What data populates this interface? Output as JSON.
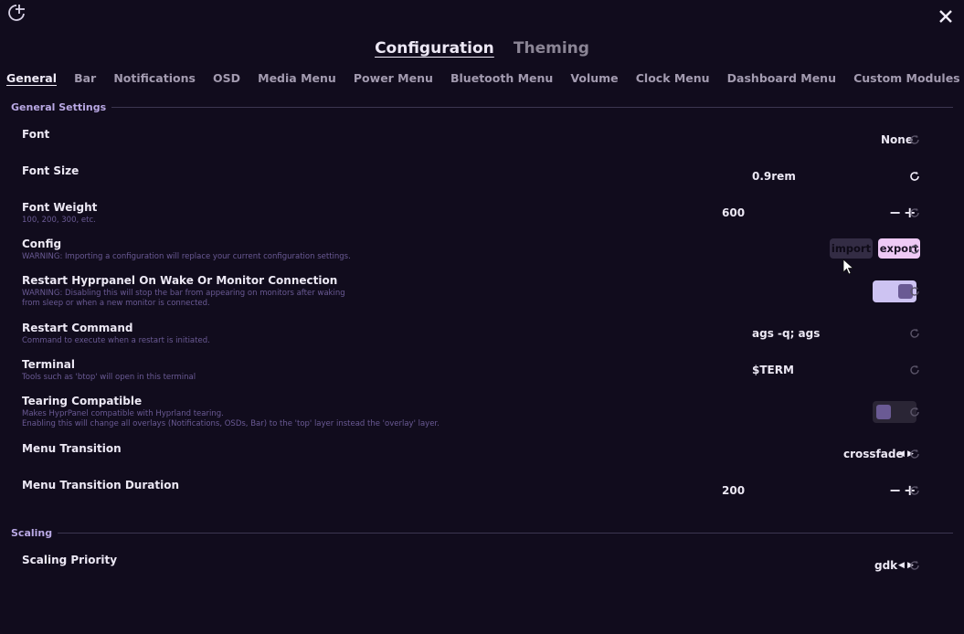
{
  "header": {
    "main_tabs": [
      {
        "label": "Configuration",
        "active": true
      },
      {
        "label": "Theming",
        "active": false
      }
    ],
    "sub_tabs": [
      {
        "label": "General",
        "active": true
      },
      {
        "label": "Bar"
      },
      {
        "label": "Notifications"
      },
      {
        "label": "OSD"
      },
      {
        "label": "Media Menu"
      },
      {
        "label": "Power Menu"
      },
      {
        "label": "Bluetooth Menu"
      },
      {
        "label": "Volume"
      },
      {
        "label": "Clock Menu"
      },
      {
        "label": "Dashboard Menu"
      },
      {
        "label": "Custom Modules"
      }
    ]
  },
  "sections": {
    "general": "General Settings",
    "scaling": "Scaling"
  },
  "settings": {
    "font": {
      "title": "Font",
      "value": "None"
    },
    "font_size": {
      "title": "Font Size",
      "value": "0.9rem"
    },
    "font_weight": {
      "title": "Font Weight",
      "subtitle": "100, 200, 300, etc.",
      "value": "600"
    },
    "config": {
      "title": "Config",
      "subtitle": "WARNING: Importing a configuration will replace your current configuration settings.",
      "import_label": "import",
      "export_label": "export"
    },
    "restart_hyprpanel": {
      "title": "Restart Hyprpanel On Wake Or Monitor Connection",
      "subtitle_1": "WARNING: Disabling this will stop the bar from appearing on monitors after waking",
      "subtitle_2": "from sleep or when a new monitor is connected.",
      "enabled": true
    },
    "restart_command": {
      "title": "Restart Command",
      "subtitle": "Command to execute when a restart is initiated.",
      "value": "ags -q; ags"
    },
    "terminal": {
      "title": "Terminal",
      "subtitle": "Tools such as 'btop' will open in this terminal",
      "value": "$TERM"
    },
    "tearing": {
      "title": "Tearing Compatible",
      "subtitle_1": "Makes HyprPanel compatible with Hyprland tearing.",
      "subtitle_2": "Enabling this will change all overlays (Notifications, OSDs, Bar) to the 'top' layer instead the 'overlay' layer.",
      "enabled": false
    },
    "menu_transition": {
      "title": "Menu Transition",
      "value": "crossfade"
    },
    "menu_transition_duration": {
      "title": "Menu Transition Duration",
      "value": "200"
    },
    "scaling_priority": {
      "title": "Scaling Priority",
      "value": "gdk"
    }
  },
  "colors": {
    "background": "#110c1d",
    "accent": "#b9a8e4",
    "subtitle": "#6a5a94",
    "export_button": "#eec9f5",
    "toggle_on": "#cdc3f2"
  }
}
